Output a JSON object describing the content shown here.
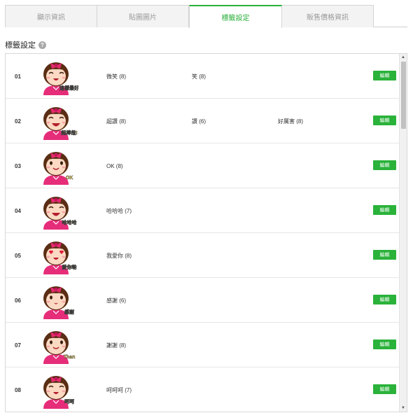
{
  "tabs": [
    {
      "label": "顯示資訊",
      "active": false
    },
    {
      "label": "貼圖圖片",
      "active": false
    },
    {
      "label": "標籤設定",
      "active": true
    },
    {
      "label": "販售價格資訊",
      "active": false
    }
  ],
  "section": {
    "title": "標籤設定",
    "help": "?"
  },
  "edit_label": "編輯",
  "rows": [
    {
      "num": "01",
      "tags": [
        "微笑 (8)",
        "笑 (8)",
        ""
      ],
      "sticker_text": "這樣最好笑"
    },
    {
      "num": "02",
      "tags": [
        "超讚 (8)",
        "讚 (6)",
        "好厲害 (8)"
      ],
      "sticker_text": "超棒哉!"
    },
    {
      "num": "03",
      "tags": [
        "OK (8)",
        "",
        ""
      ],
      "sticker_text": "OK"
    },
    {
      "num": "04",
      "tags": [
        "哈哈哈 (7)",
        "",
        ""
      ],
      "sticker_text": "哈哈哈"
    },
    {
      "num": "05",
      "tags": [
        "我愛你 (8)",
        "",
        ""
      ],
      "sticker_text": "愛你喲"
    },
    {
      "num": "06",
      "tags": [
        "感謝 (6)",
        "",
        ""
      ],
      "sticker_text": "感謝"
    },
    {
      "num": "07",
      "tags": [
        "謝謝 (8)",
        "",
        ""
      ],
      "sticker_text": "Thank You"
    },
    {
      "num": "08",
      "tags": [
        "呵呵呵 (7)",
        "",
        ""
      ],
      "sticker_text": "呵呵"
    }
  ],
  "colors": {
    "accent": "#2ab23a",
    "hair": "#5a2e14",
    "bow": "#e52a6f",
    "shirt": "#e62d7a",
    "skin": "#fbd9c2"
  }
}
